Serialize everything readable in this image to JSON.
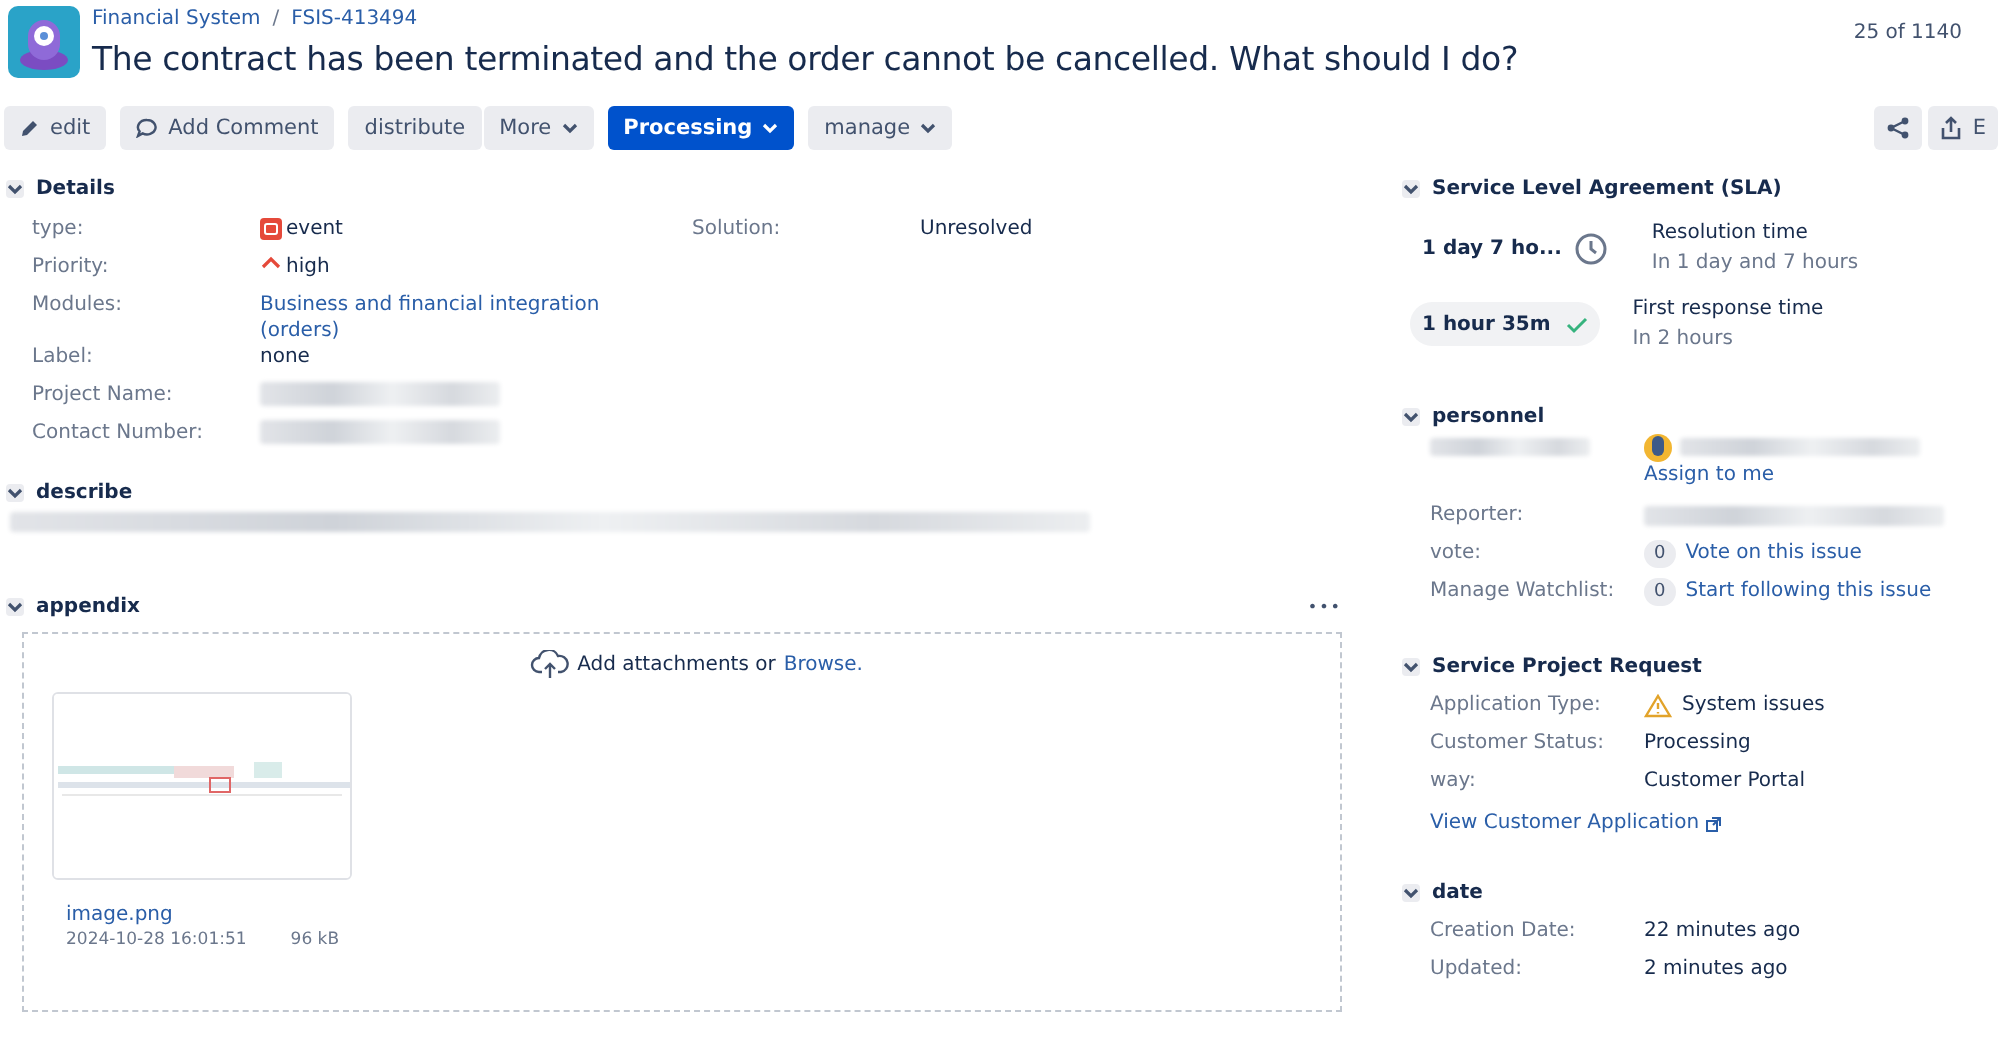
{
  "breadcrumb": {
    "project": "Financial System",
    "separator": "/",
    "issue_key": "FSIS-413494"
  },
  "title": "The contract has been terminated and the order cannot be cancelled. What should I do?",
  "pager": "25 of 1140",
  "toolbar": [
    {
      "label": "edit",
      "kind": "edit"
    },
    {
      "label": "Add Comment",
      "kind": "comment"
    },
    {
      "label": "distribute",
      "kind": "plain"
    },
    {
      "label": "More",
      "kind": "dropdown"
    },
    {
      "label": "Processing",
      "kind": "primary"
    },
    {
      "label": "manage",
      "kind": "dropdown"
    }
  ],
  "right_toolbar": [
    {
      "kind": "share"
    },
    {
      "kind": "export",
      "label": "E"
    }
  ],
  "details": {
    "title": "Details",
    "expanded": true,
    "fields": [
      {
        "label": "type:",
        "value": "event",
        "kind": "event"
      },
      {
        "label": "Priority:",
        "value": "high",
        "kind": "priority"
      },
      {
        "label": "Modules:",
        "value": "Business and financial integration (orders)",
        "kind": "link"
      },
      {
        "label": "Label:",
        "value": "none",
        "kind": "text"
      },
      {
        "label": "Project Name:",
        "kind": "redacted"
      },
      {
        "label": "Contact Number:",
        "kind": "redacted"
      }
    ],
    "side_fields": [
      {
        "label": "Solution:",
        "value": "Unresolved"
      }
    ]
  },
  "describe": {
    "title": "describe",
    "expanded": true,
    "kind": "redacted"
  },
  "appendix": {
    "title": "appendix",
    "expanded": true,
    "menu": "•••",
    "drop_text": "Add attachments or",
    "browse": "Browse.",
    "files": [
      {
        "name": "image.png",
        "date": "2024-10-28 16:01:51",
        "size": "96 kB"
      }
    ]
  },
  "sla": {
    "title": "Service Level Agreement (SLA)",
    "expanded": true,
    "items": [
      {
        "time": "1 day 7 ho...",
        "kind": "running",
        "name": "Resolution time",
        "detail": "In 1 day and 7 hours"
      },
      {
        "time": "1 hour 35m",
        "kind": "met",
        "name": "First response time",
        "detail": "In 2 hours"
      }
    ]
  },
  "personnel": {
    "title": "personnel",
    "expanded": true,
    "assign_link": "Assign to me",
    "rows": [
      {
        "label": "Reporter:",
        "kind": "redacted"
      },
      {
        "label": "vote:",
        "kind": "counter",
        "count": "0",
        "link": "Vote on this issue"
      },
      {
        "label": "Manage Watchlist:",
        "kind": "counter",
        "count": "0",
        "link": "Start following this issue"
      }
    ]
  },
  "service_request": {
    "title": "Service Project Request",
    "expanded": true,
    "rows": [
      {
        "label": "Application Type:",
        "value": "System issues",
        "kind": "warning"
      },
      {
        "label": "Customer Status:",
        "value": "Processing",
        "kind": "text"
      },
      {
        "label": "way:",
        "value": "Customer Portal",
        "kind": "text"
      }
    ],
    "link": "View Customer Application"
  },
  "date": {
    "title": "date",
    "expanded": true,
    "rows": [
      {
        "label": "Creation Date:",
        "value": "22 minutes ago"
      },
      {
        "label": "Updated:",
        "value": "2 minutes ago"
      }
    ]
  }
}
